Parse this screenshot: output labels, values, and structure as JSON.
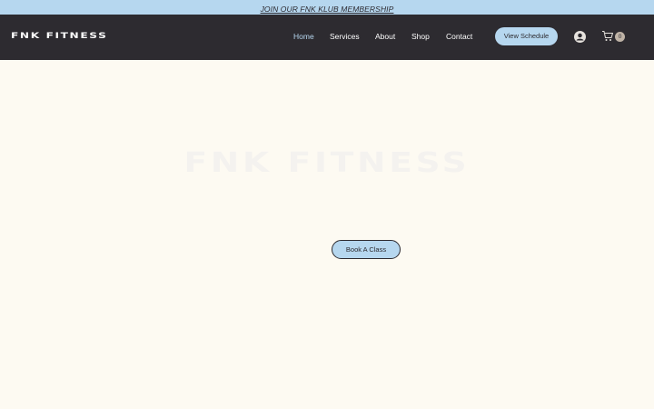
{
  "announcement": {
    "text": "JOIN OUR FNK KLUB MEMBERSHIP"
  },
  "header": {
    "logo": "FNK FITNESS",
    "nav": [
      {
        "label": "Home",
        "active": true
      },
      {
        "label": "Services",
        "active": false
      },
      {
        "label": "About",
        "active": false
      },
      {
        "label": "Shop",
        "active": false
      },
      {
        "label": "Contact",
        "active": false
      }
    ],
    "cta_label": "View Schedule",
    "account_icon": "account-icon",
    "cart_icon": "cart-icon",
    "cart_count": "0"
  },
  "hero": {
    "title": "FNK FITNESS",
    "cta_label": "Book A Class"
  },
  "colors": {
    "announce_bg": "#b6d7ef",
    "header_bg": "#2d2b30",
    "page_bg": "#fdfaf2",
    "accent": "#b6d7ef",
    "nav_active": "#b6d7ef"
  }
}
